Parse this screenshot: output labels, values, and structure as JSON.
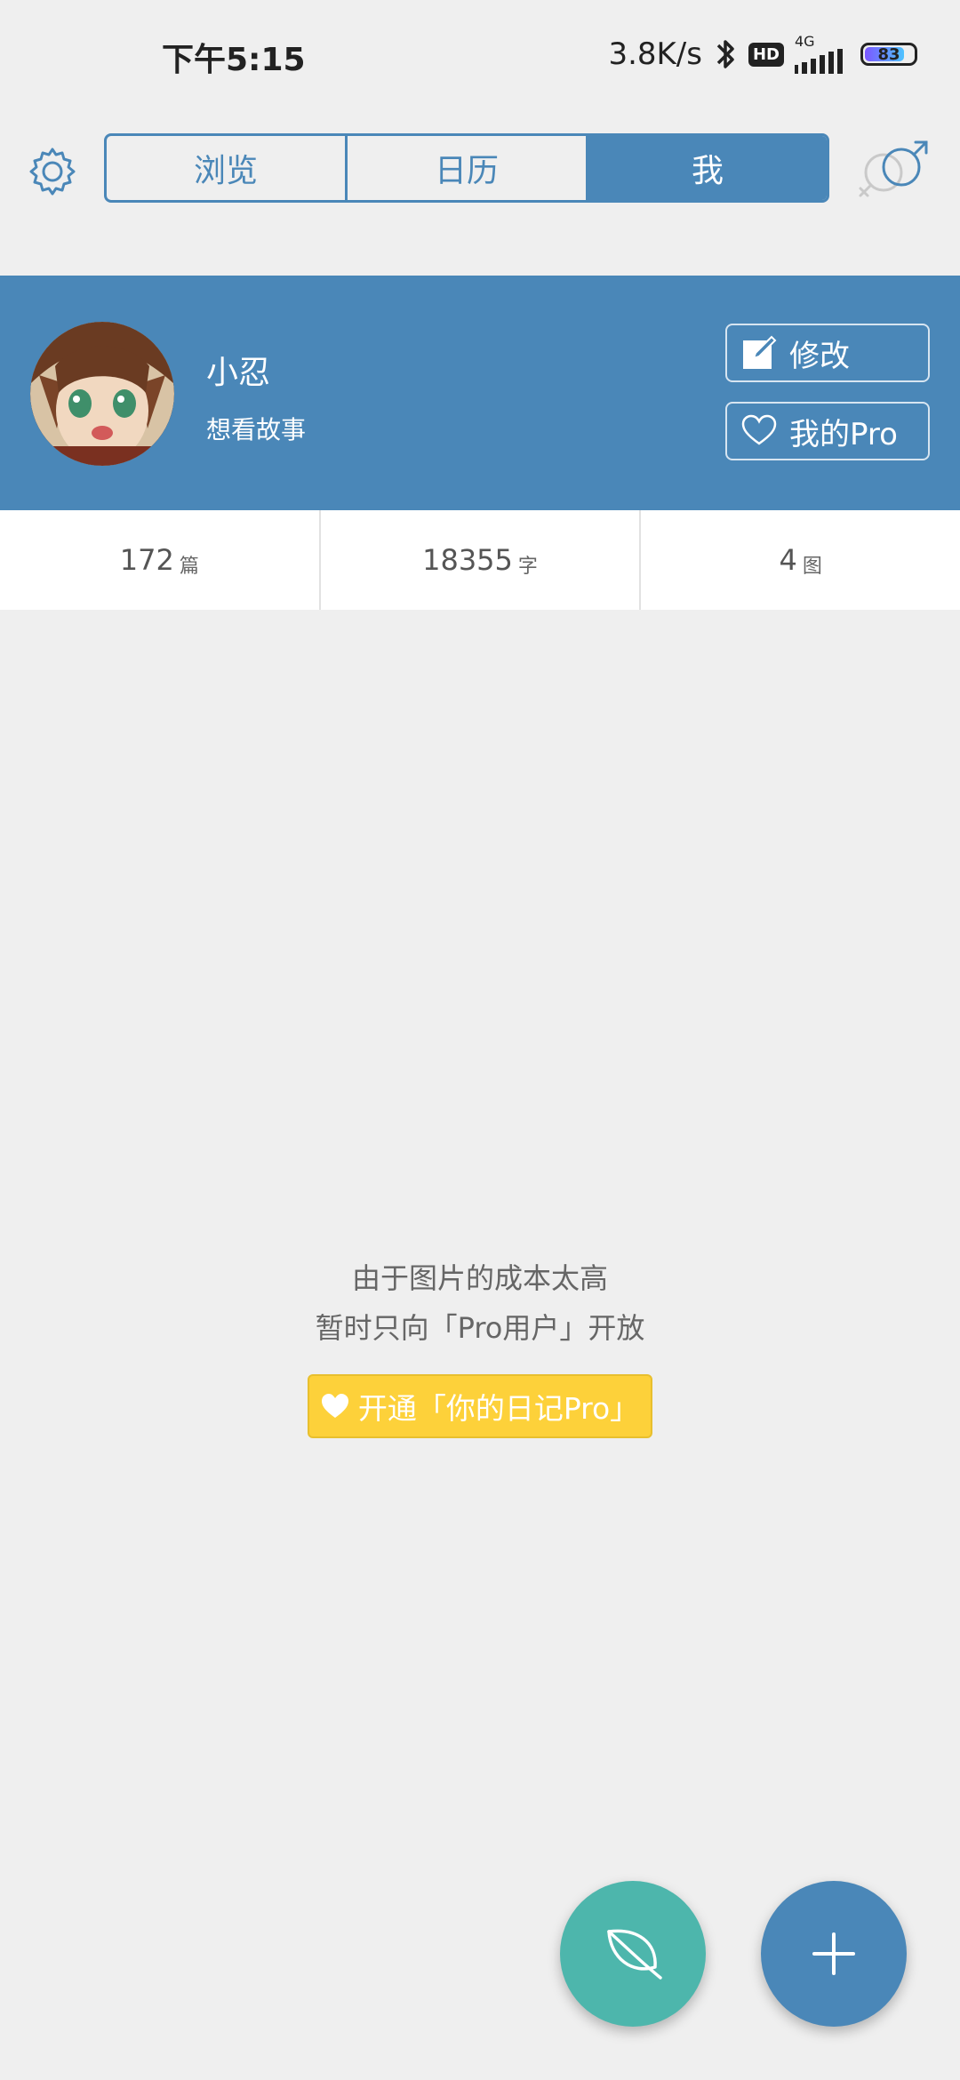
{
  "status_bar": {
    "time": "下午5:15",
    "net_speed": "3.8K/s",
    "hd": "HD",
    "network": "4G",
    "battery": "83",
    "battery_level": 83
  },
  "tabs": [
    {
      "label": "浏览",
      "active": false
    },
    {
      "label": "日历",
      "active": false
    },
    {
      "label": "我",
      "active": true
    }
  ],
  "profile": {
    "name": "小忍",
    "bio": "想看故事",
    "edit_label": "修改",
    "pro_label": "我的Pro"
  },
  "stats": [
    {
      "value": "172",
      "unit": "篇"
    },
    {
      "value": "18355",
      "unit": "字"
    },
    {
      "value": "4",
      "unit": "图"
    }
  ],
  "notice": {
    "line1": "由于图片的成本太高",
    "line2": "暂时只向「Pro用户」开放",
    "cta_label": "开通「你的日记Pro」"
  },
  "colors": {
    "primary": "#4a87b8",
    "accent_teal": "#4db6ac",
    "cta_yellow": "#fdd13a",
    "background": "#efefef"
  },
  "icons": {
    "settings": "gear-icon",
    "gender": "gender-icon",
    "edit": "edit-icon",
    "pro": "heart-icon",
    "fab_leaf": "leaf-icon",
    "fab_add": "plus-icon"
  }
}
